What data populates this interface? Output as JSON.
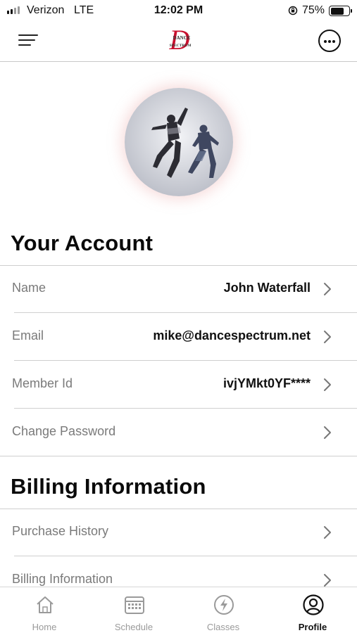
{
  "status_bar": {
    "carrier": "Verizon",
    "network": "LTE",
    "time": "12:02 PM",
    "battery": "75%",
    "battery_level": 0.75
  },
  "top_nav": {
    "menu_icon": "hamburger-menu-icon",
    "logo_text_top": "DANCE",
    "logo_text_bottom": "SPECTRUM",
    "more_icon": "more-options-icon"
  },
  "account": {
    "title": "Your Account",
    "rows": [
      {
        "label": "Name",
        "value": "John Waterfall"
      },
      {
        "label": "Email",
        "value": "mike@dancespectrum.net"
      },
      {
        "label": "Member Id",
        "value": "ivjYMkt0YF****"
      },
      {
        "label": "Change Password",
        "value": ""
      }
    ]
  },
  "billing": {
    "title": "Billing Information",
    "rows": [
      {
        "label": "Purchase History"
      },
      {
        "label": "Billing Information"
      }
    ]
  },
  "tabs": [
    {
      "label": "Home",
      "icon": "home-icon",
      "active": false
    },
    {
      "label": "Schedule",
      "icon": "calendar-icon",
      "active": false
    },
    {
      "label": "Classes",
      "icon": "lightning-icon",
      "active": false
    },
    {
      "label": "Profile",
      "icon": "user-circle-icon",
      "active": true
    }
  ],
  "colors": {
    "accent": "#c8102e",
    "label_gray": "#7a7a7a",
    "divider": "#cfcfcf"
  }
}
